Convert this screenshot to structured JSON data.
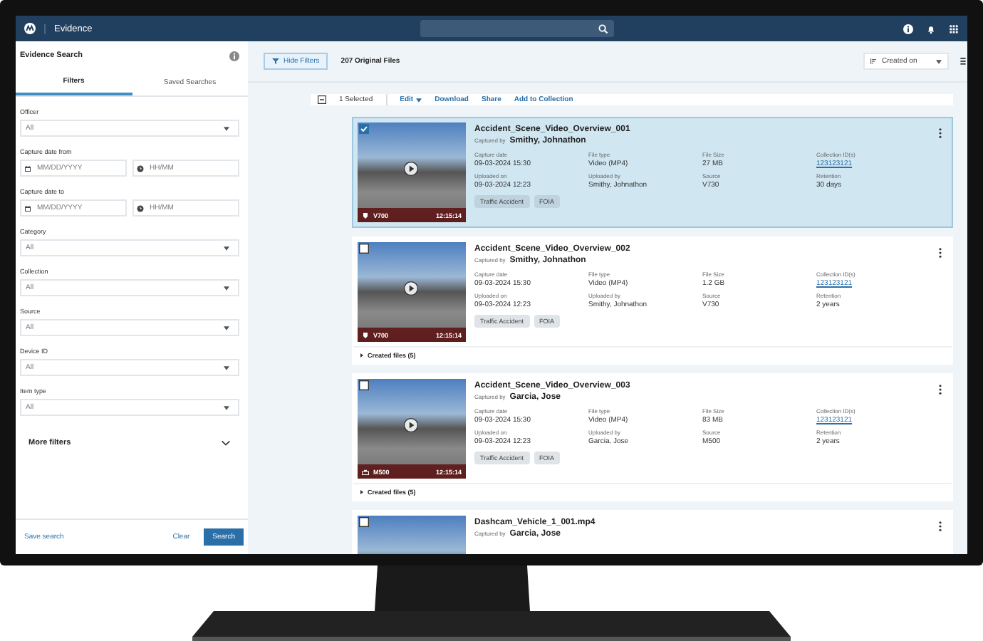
{
  "topbar": {
    "app_title": "Evidence"
  },
  "sidebar": {
    "title": "Evidence Search",
    "tabs": [
      {
        "label": "Filters",
        "selected": true
      },
      {
        "label": "Saved Searches",
        "selected": false
      }
    ],
    "filters": [
      {
        "kind": "select",
        "label": "Officer",
        "value": "All"
      },
      {
        "kind": "datetime",
        "label": "Capture date from",
        "date_placeholder": "MM/DD/YYYY",
        "time_placeholder": "HH/MM"
      },
      {
        "kind": "datetime",
        "label": "Capture date to",
        "date_placeholder": "MM/DD/YYYY",
        "time_placeholder": "HH/MM"
      },
      {
        "kind": "select",
        "label": "Category",
        "value": "All"
      },
      {
        "kind": "select",
        "label": "Collection",
        "value": "All"
      },
      {
        "kind": "select",
        "label": "Source",
        "value": "All"
      },
      {
        "kind": "select",
        "label": "Device ID",
        "value": "All"
      },
      {
        "kind": "select",
        "label": "Item type",
        "value": "All"
      }
    ],
    "more_filters": "More filters",
    "save_search": "Save search",
    "clear": "Clear",
    "search": "Search"
  },
  "toolbar": {
    "hide_filters": "Hide Filters",
    "count": "207 Original Files",
    "sort": "Created on"
  },
  "actions": {
    "selected_count": "1 Selected",
    "edit": "Edit",
    "items": [
      "Download",
      "Share",
      "Add to Collection"
    ]
  },
  "cards": [
    {
      "title": "Accident_Scene_Video_Overview_001",
      "captured_label": "Captured by",
      "captured_by": "Smithy, Johnathon",
      "selected": true,
      "kind": "body_camera",
      "device": "V700",
      "time": "12:15:14",
      "fields": [
        {
          "label": "Capture date",
          "value": "09-03-2024 15:30",
          "kind": "text"
        },
        {
          "label": "File type",
          "value": "Video (MP4)",
          "kind": "text"
        },
        {
          "label": "File Size",
          "value": "27 MB",
          "kind": "text"
        },
        {
          "label": "Collection ID(s)",
          "value": "123123121",
          "kind": "link"
        },
        {
          "label": "Uploaded on",
          "value": "09-03-2024 12:23",
          "kind": "text"
        },
        {
          "label": "Uploaded by",
          "value": "Smithy, Johnathon",
          "kind": "text"
        },
        {
          "label": "Source",
          "value": "V730",
          "kind": "text"
        },
        {
          "label": "Retention",
          "value": "30 days",
          "kind": "text"
        }
      ],
      "tags": [
        "Traffic Accident",
        "FOIA"
      ]
    },
    {
      "title": "Accident_Scene_Video_Overview_002",
      "captured_label": "Captured by",
      "captured_by": "Smithy, Johnathon",
      "selected": false,
      "kind": "body_camera",
      "device": "V700",
      "time": "12:15:14",
      "fields": [
        {
          "label": "Capture date",
          "value": "09-03-2024 15:30",
          "kind": "text"
        },
        {
          "label": "File type",
          "value": "Video (MP4)",
          "kind": "text"
        },
        {
          "label": "File Size",
          "value": "1.2 GB",
          "kind": "text"
        },
        {
          "label": "Collection ID(s)",
          "value": "123123121",
          "kind": "link"
        },
        {
          "label": "Uploaded on",
          "value": "09-03-2024 12:23",
          "kind": "text"
        },
        {
          "label": "Uploaded by",
          "value": "Smithy, Johnathon",
          "kind": "text"
        },
        {
          "label": "Source",
          "value": "V730",
          "kind": "text"
        },
        {
          "label": "Retention",
          "value": "2 years",
          "kind": "text"
        }
      ],
      "tags": [
        "Traffic Accident",
        "FOIA"
      ],
      "created_files": "Created files (5)"
    },
    {
      "title": "Accident_Scene_Video_Overview_003",
      "captured_label": "Captured by",
      "captured_by": "Garcia, Jose",
      "selected": false,
      "kind": "car_camera",
      "device": "M500",
      "time": "12:15:14",
      "fields": [
        {
          "label": "Capture date",
          "value": "09-03-2024 15:30",
          "kind": "text"
        },
        {
          "label": "File type",
          "value": "Video (MP4)",
          "kind": "text"
        },
        {
          "label": "File Size",
          "value": "83 MB",
          "kind": "text"
        },
        {
          "label": "Collection ID(s)",
          "value": "123123121",
          "kind": "link"
        },
        {
          "label": "Uploaded on",
          "value": "09-03-2024 12:23",
          "kind": "text"
        },
        {
          "label": "Uploaded by",
          "value": "Garcia, Jose",
          "kind": "text"
        },
        {
          "label": "Source",
          "value": "M500",
          "kind": "text"
        },
        {
          "label": "Retention",
          "value": "2 years",
          "kind": "text"
        }
      ],
      "tags": [
        "Traffic Accident",
        "FOIA"
      ],
      "created_files": "Created files (5)"
    },
    {
      "title": "Dashcam_Vehicle_1_001.mp4",
      "captured_label": "Captured by",
      "captured_by": "Garcia, Jose",
      "selected": false
    }
  ]
}
